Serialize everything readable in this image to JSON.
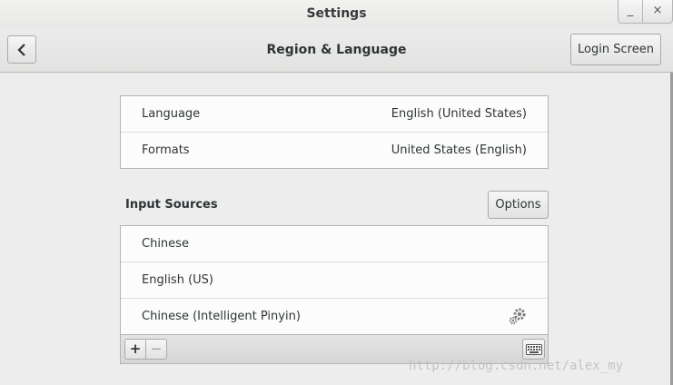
{
  "window": {
    "title": "Settings",
    "minimize_glyph": "_",
    "close_glyph": "×"
  },
  "header": {
    "back_icon": "chevron-left-icon",
    "title": "Region & Language",
    "login_button": "Login Screen"
  },
  "region": {
    "rows": [
      {
        "label": "Language",
        "value": "English (United States)"
      },
      {
        "label": "Formats",
        "value": "United States (English)"
      }
    ]
  },
  "input_sources": {
    "heading": "Input Sources",
    "options_button": "Options",
    "items": [
      {
        "label": "Chinese"
      },
      {
        "label": "English (US)"
      },
      {
        "label": "Chinese (Intelligent Pinyin)",
        "icon": "gear-icon"
      }
    ],
    "toolbar": {
      "add_label": "+",
      "remove_label": "−",
      "keyboard_icon": "keyboard-icon"
    }
  },
  "watermark": "http://blog.csdn.net/alex_my"
}
